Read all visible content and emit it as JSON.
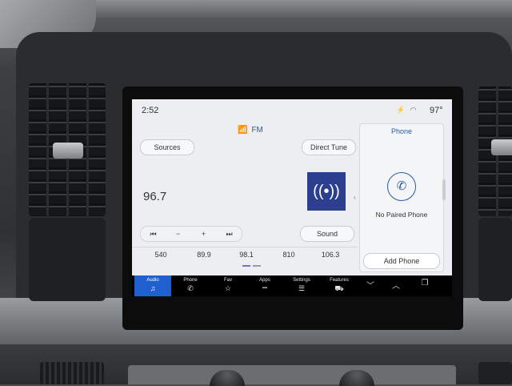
{
  "status_bar": {
    "time": "2:52",
    "icons": "⚡ ◠",
    "temperature": "97°"
  },
  "source": {
    "icon": "antenna-icon",
    "band": "FM"
  },
  "buttons": {
    "sources": "Sources",
    "direct_tune": "Direct Tune",
    "sound": "Sound"
  },
  "frequency": "96.7",
  "transport": {
    "prev": "⏮",
    "minus": "−",
    "plus": "+",
    "next": "⏭"
  },
  "presets": [
    "540",
    "89.9",
    "98.1",
    "810",
    "106.3"
  ],
  "phone_panel": {
    "title": "Phone",
    "message": "No Paired Phone",
    "add_button": "Add Phone"
  },
  "nav": [
    {
      "label": "Audio",
      "icon": "♫"
    },
    {
      "label": "Phone",
      "icon": "✆"
    },
    {
      "label": "Fav",
      "icon": "☆"
    },
    {
      "label": "Apps",
      "icon": "▪▪▪"
    },
    {
      "label": "Settings",
      "icon": "☰"
    },
    {
      "label": "Features",
      "icon": "⛟"
    }
  ],
  "nav_extra": {
    "down": "﹀",
    "up": "︿",
    "window": "❐"
  },
  "colors": {
    "accent": "#1f5fd0",
    "album_art": "#2c3f8f",
    "screen_bg": "#eceef1"
  }
}
